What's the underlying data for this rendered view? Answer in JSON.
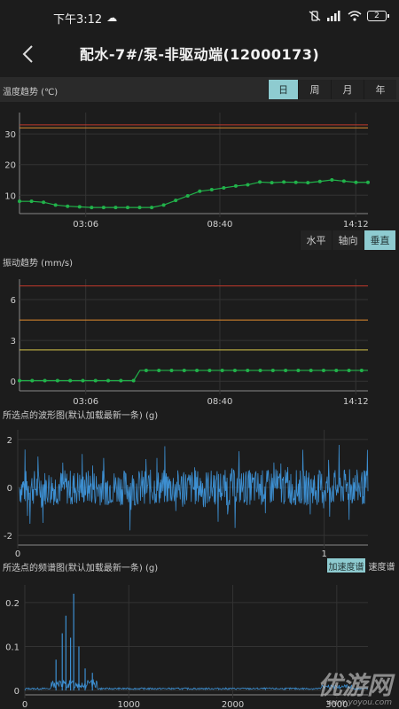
{
  "status": {
    "time": "下午3:12",
    "battery": "2"
  },
  "nav": {
    "title": "配水-7#/泵-非驱动端(12000173)"
  },
  "temperature": {
    "label": "温度趋势 (℃)",
    "range_buttons": [
      "日",
      "周",
      "月",
      "年"
    ],
    "active_range": 0
  },
  "vibration": {
    "direction_buttons": [
      "水平",
      "轴向",
      "垂直"
    ],
    "active_direction": 2,
    "label": "振动趋势 (mm/s)"
  },
  "waveform": {
    "label": "所选点的波形图(默认加载最新一条) (g)"
  },
  "spectrum": {
    "label": "所选点的频谱图(默认加载最新一条) (g)",
    "type_buttons": [
      "加速度谱",
      "速度谱"
    ],
    "active_type": 0
  },
  "watermark": {
    "text": "优游网",
    "sub": "www.yoyou.com"
  },
  "colors": {
    "accent": "#8ecbd0",
    "line": "#21b24a",
    "upper_alarm": "#c0392b",
    "mid_alarm": "#e08a2e",
    "low_alarm": "#d6c44a",
    "wave": "#3d8fd1"
  },
  "chart_data": [
    {
      "type": "line",
      "title": "温度趋势 (℃)",
      "x_ticks": [
        "03:06",
        "08:40",
        "14:12"
      ],
      "y_ticks": [
        10,
        20,
        30
      ],
      "ylim": [
        4,
        37
      ],
      "thresholds": [
        33,
        32
      ],
      "series": [
        {
          "values": [
            8,
            8,
            7.7,
            6.8,
            6.4,
            6.2,
            6.0,
            6.0,
            6.0,
            6.0,
            6.0,
            6.0,
            6.8,
            8.3,
            9.8,
            11.3,
            11.8,
            12.4,
            13.0,
            13.4,
            14.3,
            14.1,
            14.3,
            14.2,
            14.1,
            14.5,
            15.0,
            14.6,
            14.2,
            14.2
          ]
        }
      ]
    },
    {
      "type": "line",
      "title": "振动趋势 (mm/s)",
      "x_ticks": [
        "03:06",
        "08:40",
        "14:12"
      ],
      "y_ticks": [
        0,
        3,
        6
      ],
      "ylim": [
        -0.7,
        7.5
      ],
      "thresholds": [
        7.0,
        4.5,
        2.3
      ],
      "series": [
        {
          "values": [
            0.05,
            0.05,
            0.05,
            0.05,
            0.05,
            0.05,
            0.05,
            0.05,
            0.05,
            0.05,
            0.05,
            0.05,
            0.05,
            0.05,
            0.05,
            0.05,
            0.05,
            0.05,
            0.05,
            0.8,
            0.8,
            0.8,
            0.8,
            0.8,
            0.8,
            0.8,
            0.8,
            0.8,
            0.8,
            0.8,
            0.8,
            0.8,
            0.8,
            0.8,
            0.8,
            0.8,
            0.8,
            0.8,
            0.8,
            0.8,
            0.8,
            0.8,
            0.8,
            0.8,
            0.8,
            0.8,
            0.8,
            0.8,
            0.8,
            0.8,
            0.8,
            0.8,
            0.8,
            0.8,
            0.8,
            0.8
          ]
        }
      ]
    },
    {
      "type": "line",
      "title": "所选点的波形图(默认加载最新一条) (g)",
      "x_ticks": [
        "0",
        "1"
      ],
      "y_ticks": [
        -2,
        0,
        2
      ],
      "ylim": [
        -2.4,
        2.4
      ],
      "amplitude_range": [
        -2,
        2
      ]
    },
    {
      "type": "line",
      "title": "所选点的频谱图(默认加载最新一条) (g)",
      "x_ticks": [
        "0",
        "1000",
        "2000",
        "3000"
      ],
      "y_ticks": [
        0,
        0.1,
        0.2
      ],
      "ylim": [
        -0.01,
        0.24
      ],
      "xlim": [
        0,
        3300
      ],
      "peaks": [
        [
          470,
          0.22
        ],
        [
          395,
          0.17
        ],
        [
          360,
          0.13
        ],
        [
          440,
          0.12
        ],
        [
          520,
          0.1
        ],
        [
          300,
          0.07
        ],
        [
          580,
          0.05
        ],
        [
          650,
          0.04
        ]
      ]
    }
  ]
}
